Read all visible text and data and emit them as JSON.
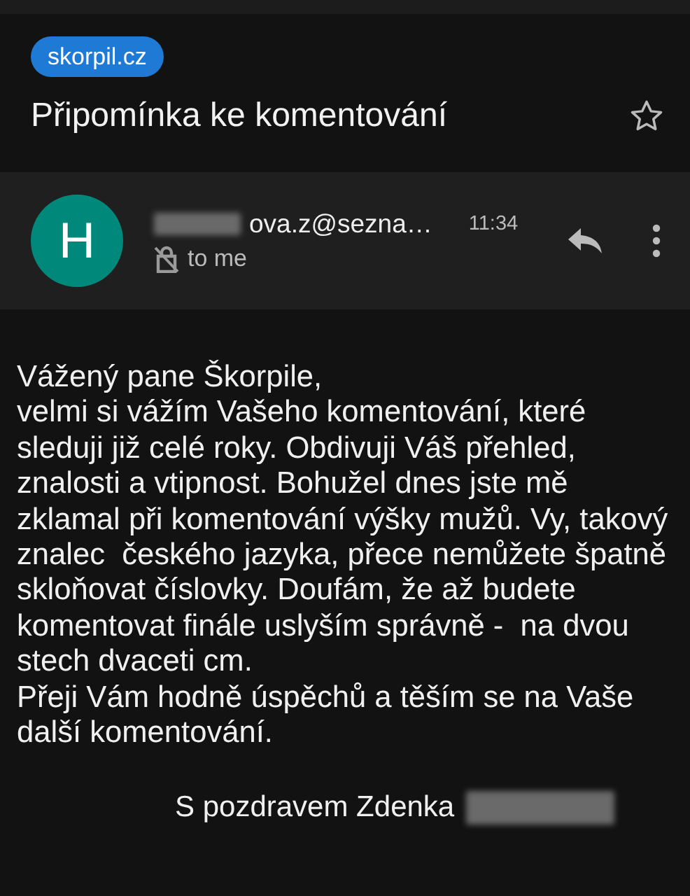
{
  "label": "skorpil.cz",
  "subject": "Připomínka ke komentování",
  "starred": false,
  "sender": {
    "avatar_letter": "H",
    "address": "ova.z@sezna…",
    "time": "11:34",
    "recipient": "to me"
  },
  "body_lines": [
    "Vážený pane Škorpile,",
    "velmi si vážím Vašeho komentování, které",
    "sleduji již celé roky. Obdivuji Váš přehled,",
    "znalosti a vtipnost. Bohužel dnes jste mě",
    "zklamal při komentování výšky mužů. Vy, takový",
    "znalec  českého jazyka, přece nemůžete špatně",
    "skloňovat číslovky. Doufám, že až budete",
    "komentovat finále uslyším správně -  na dvou",
    "stech dvaceti cm.",
    "Přeji Vám hodně úspěchů a těším se na Vaše",
    "další komentování."
  ],
  "signature": "S pozdravem Zdenka"
}
